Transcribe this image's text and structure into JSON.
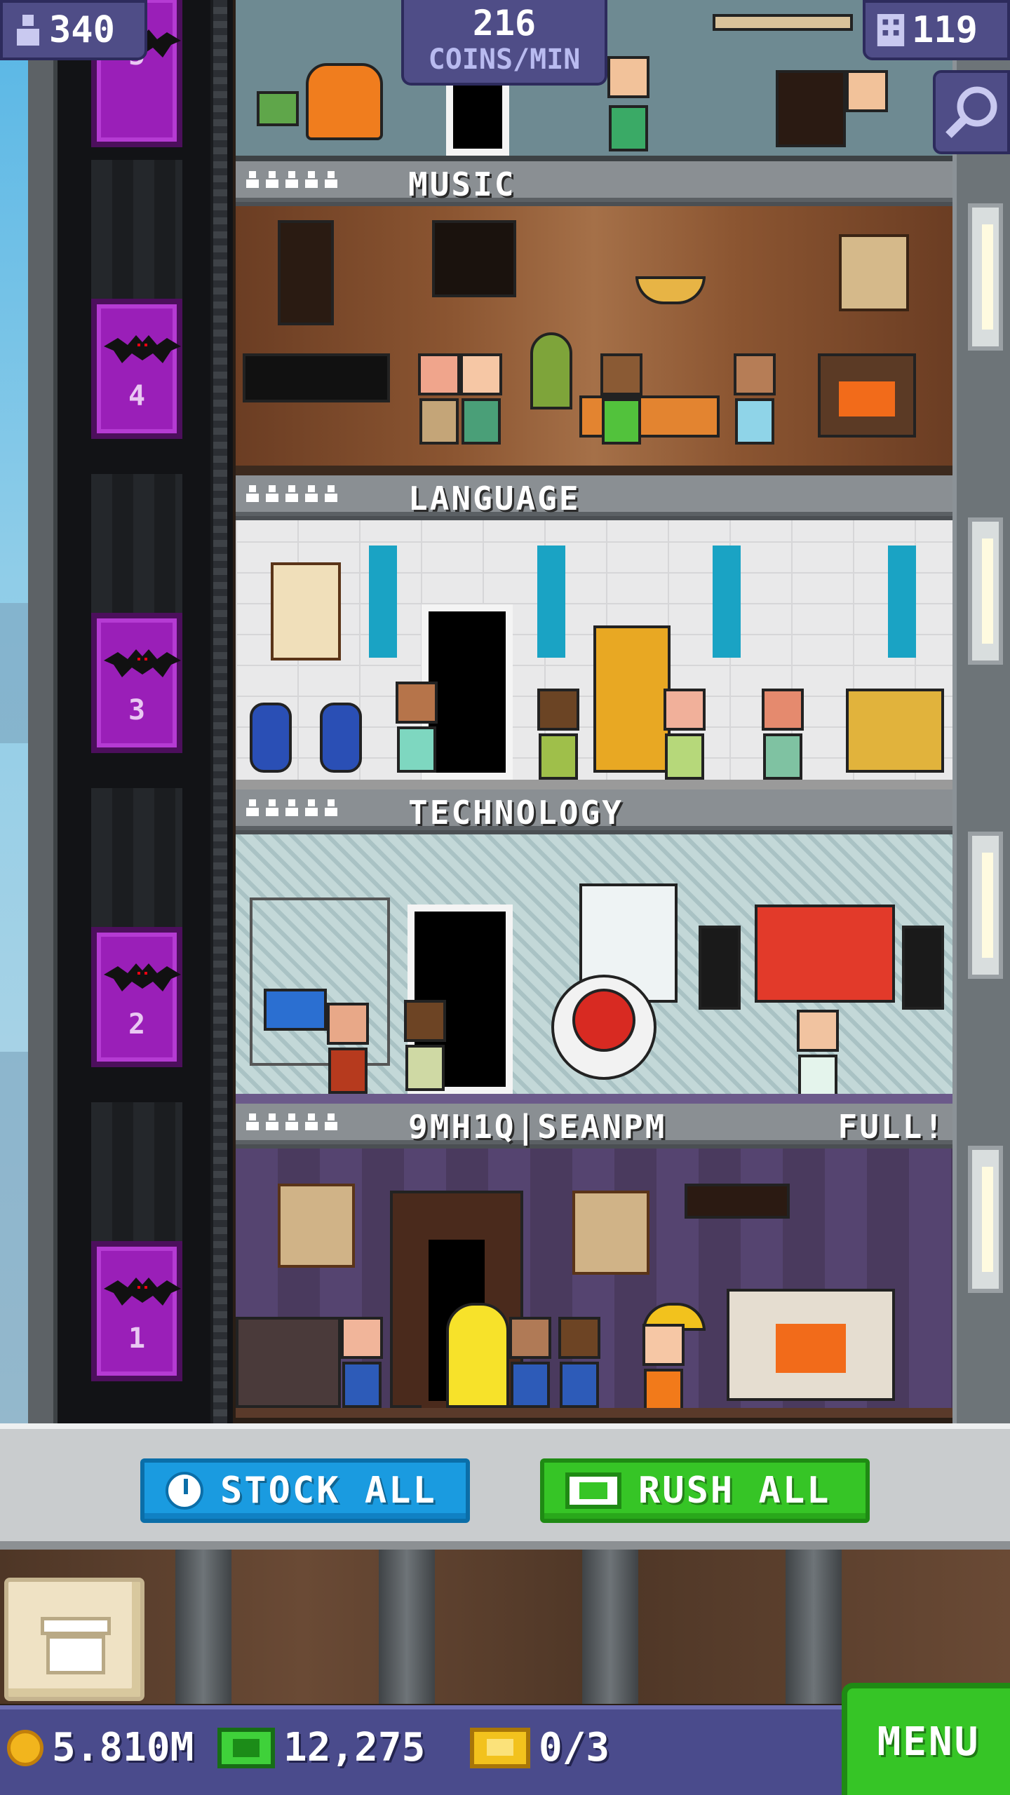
{
  "hud": {
    "population": "340",
    "coins_per_min_value": "216",
    "coins_per_min_unit": "COINS/MIN",
    "floor_count": "119",
    "search_icon": "magnifier-icon"
  },
  "elevator": {
    "car_numbers": [
      "5",
      "4",
      "3",
      "2",
      "1"
    ],
    "car_color": "#9a1fb8"
  },
  "floors": [
    {
      "name": "MUSIC",
      "status": "",
      "pips": 5
    },
    {
      "name": "LANGUAGE",
      "status": "",
      "pips": 5
    },
    {
      "name": "TECHNOLOGY",
      "status": "",
      "pips": 5
    },
    {
      "name": "9MH1Q|SEANPM",
      "status": "FULL!",
      "pips": 5
    }
  ],
  "actions": {
    "stock_all": "STOCK ALL",
    "rush_all": "RUSH ALL"
  },
  "status": {
    "coins": "5.810M",
    "bux": "12,275",
    "tickets": "0/3",
    "menu": "MENU"
  },
  "colors": {
    "stock_button": "#1a9be0",
    "rush_button": "#36c526",
    "status_bar": "#4a4b8c",
    "menu_button": "#36c526"
  }
}
